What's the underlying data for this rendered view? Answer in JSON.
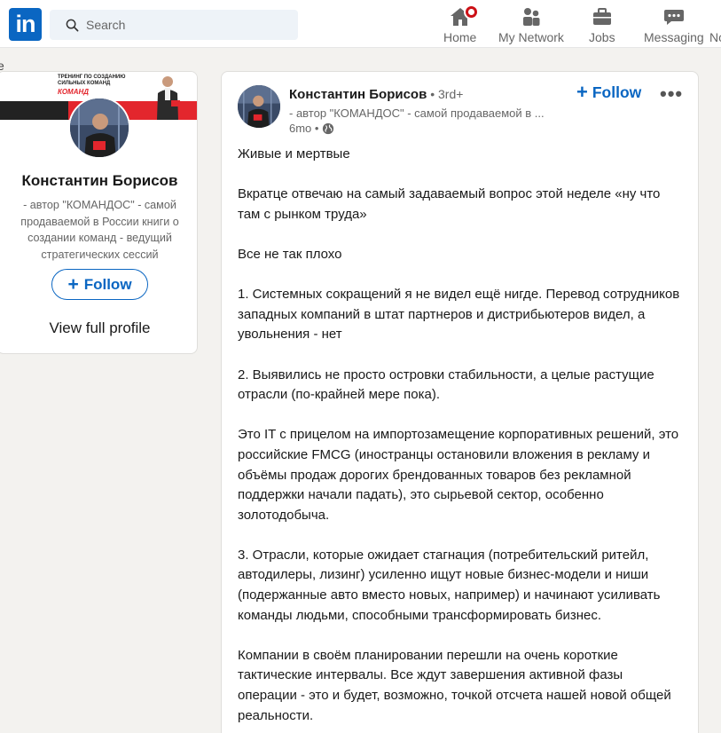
{
  "nav": {
    "logo": "in",
    "search_placeholder": "Search",
    "items": [
      {
        "label": "Home",
        "icon": "home-icon"
      },
      {
        "label": "My Network",
        "icon": "people-icon"
      },
      {
        "label": "Jobs",
        "icon": "briefcase-icon"
      },
      {
        "label": "Messaging",
        "icon": "chat-icon"
      },
      {
        "label": "No",
        "icon": "bell-icon"
      }
    ],
    "left_edge_fragment": "e"
  },
  "profile_card": {
    "cover_text": "ТРЕНИНГ ПО СОЗДАНИЮ СИЛЬНЫХ КОМАНД",
    "cover_brand": "КОМАНД",
    "name": "Константин Борисов",
    "headline": "- автор \"КОМАНДОС\" - самой продаваемой в России книги о создании команд - ведущий стратегических сессий",
    "follow_label": "Follow",
    "view_profile_label": "View full profile"
  },
  "post": {
    "author_name": "Константин Борисов",
    "degree": " • 3rd+",
    "author_headline": "- автор \"КОМАНДОС\" - самой продаваемой в ...",
    "time": "6mo •",
    "follow_label": "Follow",
    "more_label": "•••",
    "paragraphs": [
      "Живые и мертвые",
      "Вкратце отвечаю на самый задаваемый вопрос этой неделе «ну что там с рынком труда»",
      "Все не так плохо",
      "1. Системных сокращений я не видел ещё нигде. Перевод сотрудников западных компаний в штат партнеров и дистрибьютеров видел, а увольнения - нет",
      "2. Выявились не просто островки стабильности, а целые растущие отрасли (по-крайней мере пока).",
      "Это IT с прицелом на импортозамещение корпоративных решений, это российские FMCG (иностранцы остановили вложения в рекламу и объёмы продаж дорогих брендованных товаров без рекламной поддержки начали падать), это сырьевой сектор, особенно золотодобыча.",
      "3. Отрасли, которые ожидает стагнация (потребительский ритейл, автодилеры, лизинг) усиленно ищут новые бизнес-модели и ниши (подержанные авто вместо новых, например) и начинают усиливать команды людьми, способными трансформировать бизнес.",
      "Компании в своём планировании перешли на очень короткие тактические интервалы. Все ждут завершения активной фазы операции - это и будет, возможно, точкой отсчета нашей новой общей реальности."
    ]
  },
  "colors": {
    "brand": "#0a66c2",
    "background": "#f3f2ef",
    "notification": "#cc1016",
    "cover_red": "#e3262d"
  }
}
